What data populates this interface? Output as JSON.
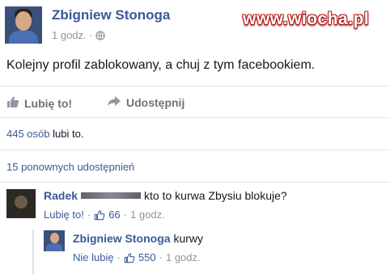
{
  "post": {
    "author": "Zbigniew Stonoga",
    "time": "1 godz.",
    "separator": "·",
    "privacy_icon": "globe-icon",
    "text": "Kolejny profil zablokowany, a chuj z tym facebookiem."
  },
  "watermark": "www.wiocha.pl",
  "actions": {
    "like_label": "Lubię to!",
    "share_label": "Udostępnij"
  },
  "stats": {
    "likes_count": "445 osób",
    "likes_suffix": "lubi to.",
    "shares_text": "15 ponownych udostępnień"
  },
  "comments": [
    {
      "author": "Radek",
      "text": "kto to kurwa Zbysiu blokuje?",
      "action_label": "Lubię to!",
      "separator": "·",
      "like_count": "66",
      "time": "1 godz."
    },
    {
      "author": "Zbigniew Stonoga",
      "text": "kurwy",
      "action_label": "Nie lubię",
      "separator": "·",
      "like_count": "550",
      "time": "1 godz."
    }
  ],
  "colors": {
    "link": "#3b5998",
    "meta": "#90949c",
    "action_text": "#6d7278",
    "watermark_outline": "#b31212"
  }
}
